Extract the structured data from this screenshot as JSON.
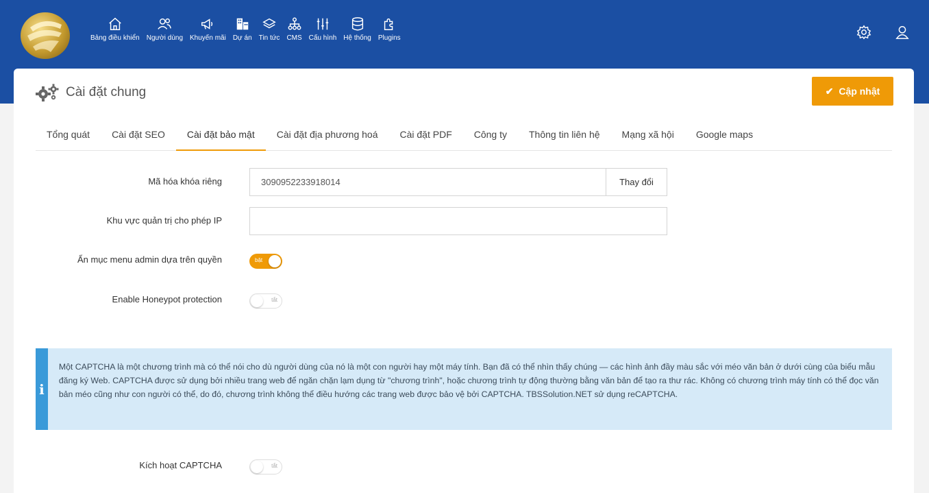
{
  "nav": {
    "items": [
      {
        "label": "Bảng điều khiển",
        "icon": "home-icon"
      },
      {
        "label": "Người dùng",
        "icon": "users-icon"
      },
      {
        "label": "Khuyến mãi",
        "icon": "megaphone-icon"
      },
      {
        "label": "Dự án",
        "icon": "building-icon"
      },
      {
        "label": "Tin tức",
        "icon": "layers-icon"
      },
      {
        "label": "CMS",
        "icon": "sitemap-icon"
      },
      {
        "label": "Cấu hình",
        "icon": "sliders-icon"
      },
      {
        "label": "Hệ thống",
        "icon": "database-icon"
      },
      {
        "label": "Plugins",
        "icon": "puzzle-icon"
      }
    ]
  },
  "header": {
    "title": "Cài đặt chung"
  },
  "toolbar": {
    "update_label": "Cập nhật"
  },
  "tabs": [
    {
      "label": "Tổng quát",
      "active": false
    },
    {
      "label": "Cài đặt SEO",
      "active": false
    },
    {
      "label": "Cài đặt bảo mật",
      "active": true
    },
    {
      "label": "Cài đặt địa phương hoá",
      "active": false
    },
    {
      "label": "Cài đặt PDF",
      "active": false
    },
    {
      "label": "Công ty",
      "active": false
    },
    {
      "label": "Thông tin liên hệ",
      "active": false
    },
    {
      "label": "Mạng xã hội",
      "active": false
    },
    {
      "label": "Google maps",
      "active": false
    }
  ],
  "form": {
    "private_key": {
      "label": "Mã hóa khóa riêng",
      "value": "3090952233918014",
      "button": "Thay đổi"
    },
    "admin_ip": {
      "label": "Khu vực quản trị cho phép IP",
      "value": ""
    },
    "hide_menu": {
      "label": "Ẩn mục menu admin dựa trên quyền",
      "state": "bật",
      "on": true
    },
    "honeypot": {
      "label": "Enable Honeypot protection",
      "state": "tắt",
      "on": false
    },
    "captcha": {
      "label": "Kích hoạt CAPTCHA",
      "state": "tắt",
      "on": false
    }
  },
  "info": {
    "icon": "i",
    "text": "Một CAPTCHA là một chương trình mà có thể nói cho dù người dùng của nó là một con người hay một máy tính. Bạn đã có thể nhìn thấy chúng — các hình ảnh đầy màu sắc với méo văn bản ở dưới cùng của biểu mẫu đăng ký Web. CAPTCHA được sử dụng bởi nhiều trang web để ngăn chặn lạm dụng từ \"chương trình\", hoặc chương trình tự động thường bằng văn bản để tạo ra thư rác. Không có chương trình máy tính có thể đọc văn bản méo cũng như con người có thể, do đó, chương trình không thể điều hướng các trang web được bảo vệ bởi CAPTCHA. TBSSolution.NET sử dụng reCAPTCHA."
  },
  "colors": {
    "brand": "#1b4fa3",
    "accent": "#ef9a07",
    "info_bg": "#d6eaf8",
    "info_bar": "#3a9ad9"
  }
}
